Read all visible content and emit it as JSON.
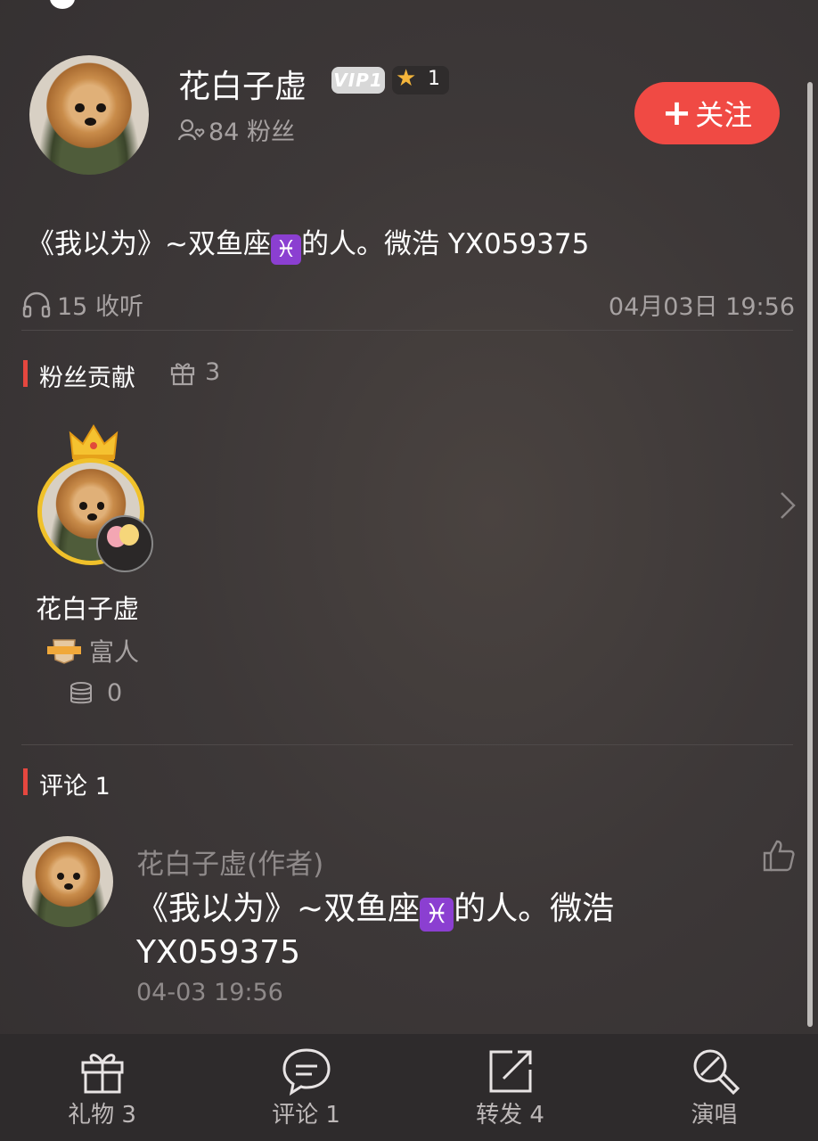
{
  "header": {
    "username": "花白子虚",
    "vip_label": "VIP1",
    "star_count": "1",
    "fans_text": "84 粉丝",
    "follow_label": "关注"
  },
  "post": {
    "text_before": "《我以为》~双鱼座",
    "text_after": "的人。微浩 YX059375",
    "zodiac_symbol": "♓",
    "listens": "15 收听",
    "datetime": "04月03日 19:56"
  },
  "fans_contribution": {
    "title": "粉丝贡献",
    "gift_count": "3",
    "contributors": [
      {
        "name": "花白子虚",
        "title": "富人",
        "coins": "0"
      }
    ]
  },
  "comments": {
    "title": "评论 1",
    "items": [
      {
        "author": "花白子虚(作者)",
        "text_before": "《我以为》~双鱼座",
        "text_after": "的人。微浩",
        "text_line2": "YX059375",
        "time": "04-03 19:56"
      }
    ]
  },
  "tabbar": {
    "items": [
      {
        "label": "礼物 3",
        "icon": "gift-icon"
      },
      {
        "label": "评论 1",
        "icon": "comment-icon"
      },
      {
        "label": "转发 4",
        "icon": "share-icon"
      },
      {
        "label": "演唱",
        "icon": "microphone-icon"
      }
    ]
  },
  "colors": {
    "accent": "#f04a44",
    "background": "#3d3838",
    "section_mark": "#e5473f"
  }
}
